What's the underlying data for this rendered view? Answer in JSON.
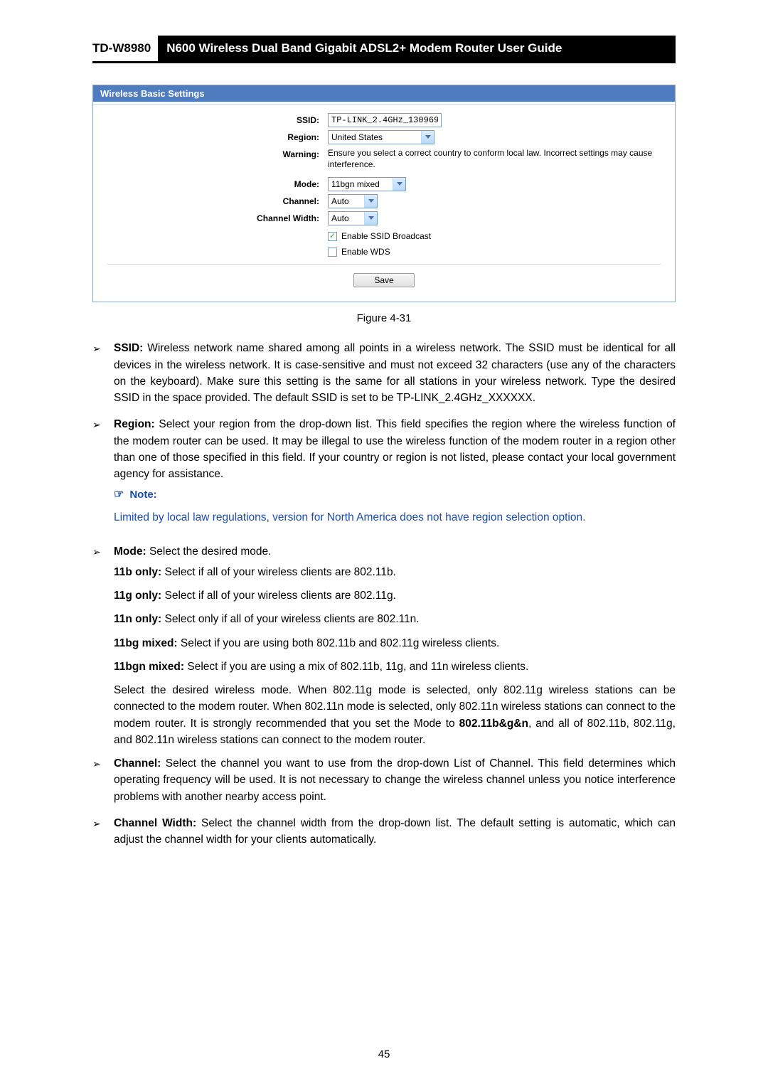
{
  "header": {
    "model": "TD-W8980",
    "title": "N600 Wireless Dual Band Gigabit ADSL2+ Modem Router User Guide"
  },
  "panel": {
    "title": "Wireless Basic Settings",
    "ssid_label": "SSID:",
    "ssid_value": "TP-LINK_2.4GHz_130969",
    "region_label": "Region:",
    "region_value": "United States",
    "warning_label": "Warning:",
    "warning_text": "Ensure you select a correct country to conform local law. Incorrect settings may cause interference.",
    "mode_label": "Mode:",
    "mode_value": "11bgn mixed",
    "channel_label": "Channel:",
    "channel_value": "Auto",
    "width_label": "Channel Width:",
    "width_value": "Auto",
    "ssid_broadcast_label": "Enable SSID Broadcast",
    "wds_label": "Enable WDS",
    "save_label": "Save"
  },
  "figure_caption": "Figure 4-31",
  "content": {
    "ssid_b": "SSID:",
    "ssid_t": " Wireless network name shared among all points in a wireless network. The SSID must be identical for all devices in the wireless network. It is case-sensitive and must not exceed 32 characters (use any of the characters on the keyboard). Make sure this setting is the same for all stations in your wireless network. Type the desired SSID in the space provided. The default SSID is set to be TP-LINK_2.4GHz_XXXXXX.",
    "region_b": "Region:",
    "region_t": " Select your region from the drop-down list. This field specifies the region where the wireless function of the modem router can be used. It may be illegal to use the wireless function of the modem router in a region other than one of those specified in this field. If your country or region is not listed, please contact your local government agency for assistance.",
    "note_label": "Note:",
    "note_text": "Limited by local law regulations, version for North America does not have region selection option.",
    "mode_b": "Mode:",
    "mode_t": " Select the desired mode.",
    "m_11b_b": "11b only:",
    "m_11b_t": " Select if all of your wireless clients are 802.11b.",
    "m_11g_b": "11g only:",
    "m_11g_t": " Select if all of your wireless clients are 802.11g.",
    "m_11n_b": "11n only:",
    "m_11n_t": " Select only if all of your wireless clients are 802.11n.",
    "m_11bg_b": "11bg mixed:",
    "m_11bg_t": " Select if you are using both 802.11b and 802.11g wireless clients.",
    "m_11bgn_b": "11bgn mixed:",
    "m_11bgn_t": " Select if you are using a mix of 802.11b, 11g, and 11n wireless clients.",
    "mode_para_1": "Select the desired wireless mode. When 802.11g mode is selected, only 802.11g wireless stations can be connected to the modem router. When 802.11n mode is selected, only 802.11n wireless stations can connect to the modem router. It is strongly recommended that you set the Mode to ",
    "mode_para_b": "802.11b&g&n",
    "mode_para_2": ", and all of 802.11b, 802.11g, and 802.11n wireless stations can connect to the modem router.",
    "channel_b": "Channel:",
    "channel_t": " Select the channel you want to use from the drop-down List of Channel. This field determines which operating frequency will be used. It is not necessary to change the wireless channel unless you notice interference problems with another nearby access point.",
    "cwidth_b": "Channel Width:",
    "cwidth_t": " Select the channel width from the drop-down list. The default setting is automatic, which can adjust the channel width for your clients automatically."
  },
  "page_number": "45"
}
